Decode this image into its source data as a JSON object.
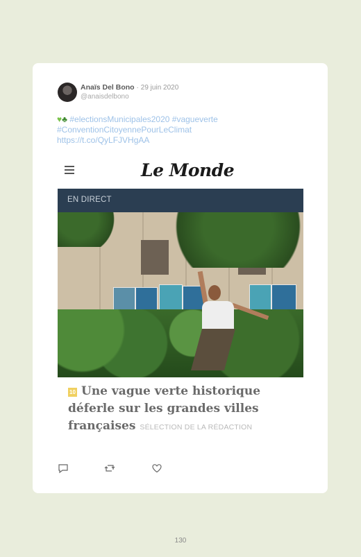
{
  "tweet": {
    "author_name": "Anaïs Del Bono",
    "date": "29 juin 2020",
    "date_separator": "·",
    "handle": "@anaisdelbono",
    "emoji_heart": "♥",
    "emoji_tree": "♣",
    "hashtags_line1": "#electionsMunicipales2020 #vagueverte",
    "hashtags_line2": "#ConventionCitoyennePourLeClimat",
    "link": "https://t.co/QyLFJVHgAA"
  },
  "embed": {
    "logo": "Le Monde",
    "live_label": "EN DIRECT",
    "badge_label": "10",
    "headline_line1": "Une vague verte historique",
    "headline_line2": "déferle sur les grandes villes",
    "headline_line3": "françaises",
    "selection_label": "SÉLECTION DE LA RÉDACTION"
  },
  "actions": {
    "reply_icon": "reply-icon",
    "retweet_icon": "retweet-icon",
    "like_icon": "heart-icon"
  },
  "page_number": "130",
  "colors": {
    "background": "#e9eddc",
    "link": "#9ec2e8",
    "live_bar": "#2b3e52"
  }
}
